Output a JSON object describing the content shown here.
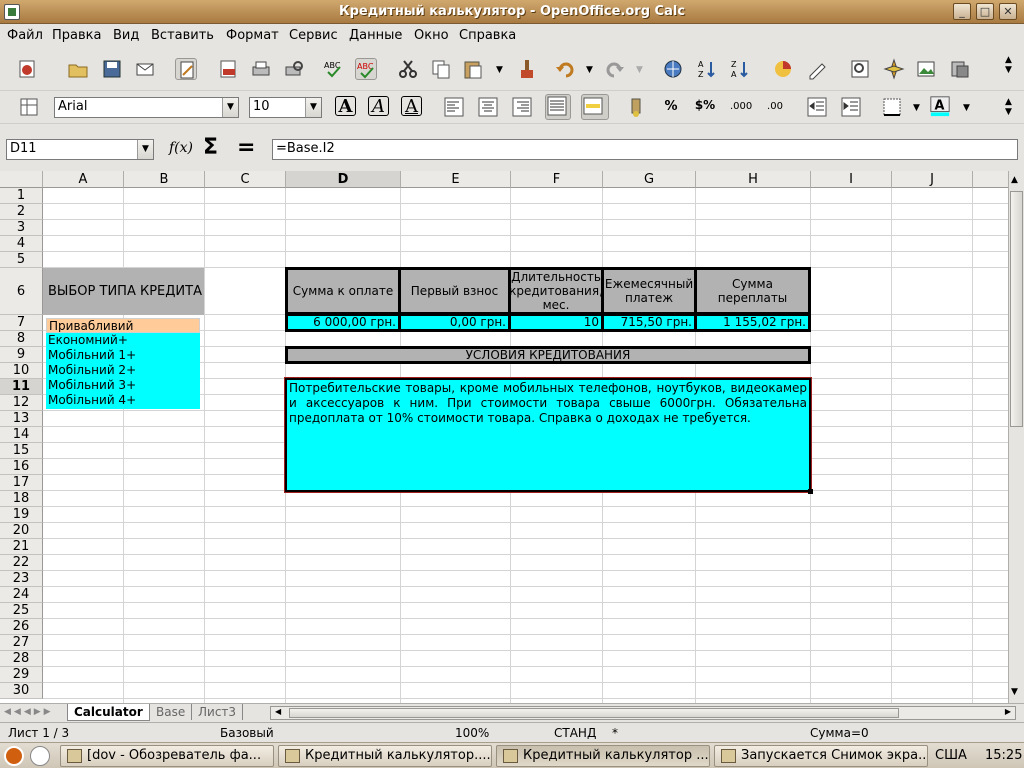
{
  "window": {
    "title": "Кредитный калькулятор - OpenOffice.org Calc",
    "btn_min": "_",
    "btn_max": "□",
    "btn_close": "✕"
  },
  "menu": [
    "Файл",
    "Правка",
    "Вид",
    "Вставить",
    "Формат",
    "Сервис",
    "Данные",
    "Окно",
    "Справка"
  ],
  "format_toolbar": {
    "font": "Arial",
    "size": "10"
  },
  "formula_bar": {
    "cell_ref": "D11",
    "function_icon": "f(x)",
    "sum_icon": "Σ",
    "equals_icon": "=",
    "formula": "=Base.I2"
  },
  "columns": [
    "A",
    "B",
    "C",
    "D",
    "E",
    "F",
    "G",
    "H",
    "I",
    "J"
  ],
  "rows": [
    "1",
    "2",
    "3",
    "4",
    "5",
    "6",
    "7",
    "8",
    "9",
    "10",
    "11",
    "12",
    "13",
    "14",
    "15",
    "16",
    "17",
    "18",
    "19",
    "20",
    "21",
    "22",
    "23",
    "24",
    "25",
    "26",
    "27",
    "28",
    "29",
    "30"
  ],
  "sheet": {
    "credit_type_header": "ВЫБОР ТИПА КРЕДИТА",
    "credit_types": [
      "Привабливий",
      "Економний+",
      "Мобільний 1+",
      "Мобільний 2+",
      "Мобільний 3+",
      "Мобільний 4+"
    ],
    "table_headers": {
      "amount": "Сумма к оплате",
      "down_payment": "Первый взнос",
      "duration": "Длительность кредитования, мес.",
      "monthly": "Ежемесячный платеж",
      "overpay": "Сумма переплаты"
    },
    "table_values": {
      "amount": "6 000,00 грн.",
      "down_payment": "0,00 грн.",
      "duration": "10",
      "monthly": "715,50 грн.",
      "overpay": "1 155,02 грн."
    },
    "conditions_title": "УСЛОВИЯ КРЕДИТОВАНИЯ",
    "conditions_text": "Потребительские товары, кроме мобильных телефонов, ноутбуков, видеокамер и аксессуаров к ним. При стоимости товара свыше 6000грн. Обязательна предоплата от 10% стоимости товара. Справка о доходах не требуется."
  },
  "sheet_tabs": [
    "Calculator",
    "Base",
    "Лист3"
  ],
  "status": {
    "sheet": "Лист 1 / 3",
    "style": "Базовый",
    "zoom": "100%",
    "mode": "СТАНД",
    "modified": "*",
    "sum": "Сумма=0"
  },
  "taskbar": {
    "items": [
      "[dov - Обозреватель фа...",
      "Кредитный калькулятор....",
      "Кредитный калькулятор ...",
      "Запускается Снимок экра..."
    ],
    "layout": "США",
    "clock": "15:25"
  },
  "colors": {
    "cyan": "#00ffff",
    "gray_header": "#b2b2b2",
    "selected_type": "#ffcc99",
    "title_bar": "#c09058"
  }
}
